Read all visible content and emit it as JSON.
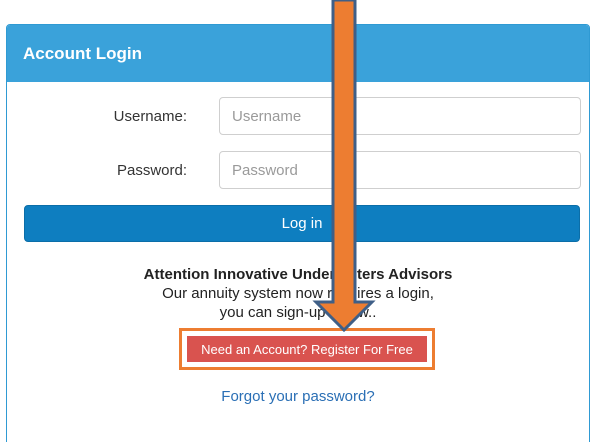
{
  "panel": {
    "title": "Account Login"
  },
  "form": {
    "username_label": "Username:",
    "username_placeholder": "Username",
    "password_label": "Password:",
    "password_placeholder": "Password",
    "login_label": "Log in"
  },
  "notice": {
    "title": "Attention Innovative Underwriters Advisors",
    "line1": "Our annuity system now requires a login,",
    "line2": "you can sign-up below.."
  },
  "register": {
    "label": "Need an Account?  Register For Free"
  },
  "forgot": {
    "label": "Forgot your password?"
  },
  "colors": {
    "heading": "#3aa2da",
    "login_button": "#0e7ec0",
    "register_button": "#d9534f",
    "annotation_arrow": "#ed7d31",
    "link": "#2a6fb5"
  }
}
